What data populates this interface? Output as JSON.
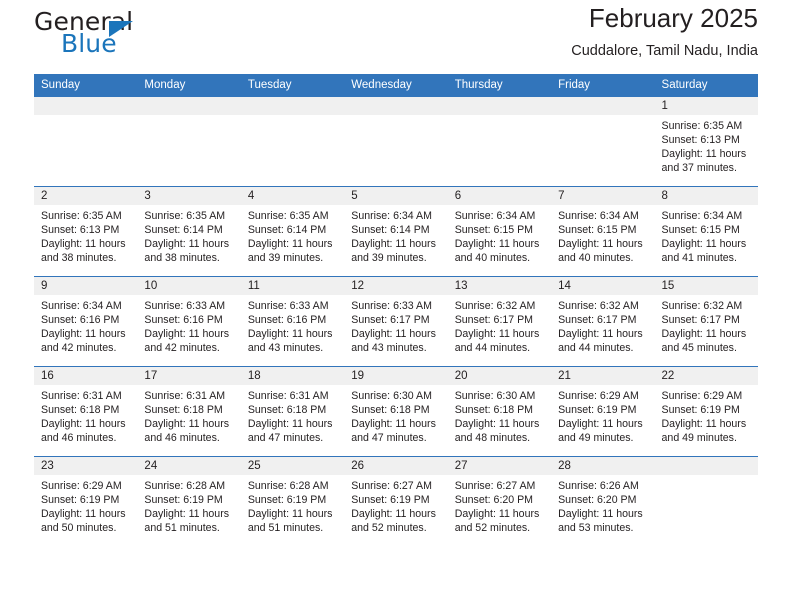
{
  "brand": {
    "word1": "General",
    "word2": "Blue",
    "logo_icon": "triangle-right-icon",
    "accent_color": "#1b75bb"
  },
  "header": {
    "title": "February 2025",
    "location": "Cuddalore, Tamil Nadu, India"
  },
  "theme": {
    "header_bar_color": "#3275bb",
    "daynum_band_color": "#f0f0f0",
    "text_color": "#231f20"
  },
  "labels": {
    "sunrise_prefix": "Sunrise:",
    "sunset_prefix": "Sunset:",
    "daylight_prefix": "Daylight:"
  },
  "weekdays": [
    "Sunday",
    "Monday",
    "Tuesday",
    "Wednesday",
    "Thursday",
    "Friday",
    "Saturday"
  ],
  "weeks": [
    [
      {
        "day": "",
        "sunrise": "",
        "sunset": "",
        "daylight": "",
        "empty": true
      },
      {
        "day": "",
        "sunrise": "",
        "sunset": "",
        "daylight": "",
        "empty": true
      },
      {
        "day": "",
        "sunrise": "",
        "sunset": "",
        "daylight": "",
        "empty": true
      },
      {
        "day": "",
        "sunrise": "",
        "sunset": "",
        "daylight": "",
        "empty": true
      },
      {
        "day": "",
        "sunrise": "",
        "sunset": "",
        "daylight": "",
        "empty": true
      },
      {
        "day": "",
        "sunrise": "",
        "sunset": "",
        "daylight": "",
        "empty": true
      },
      {
        "day": "1",
        "sunrise": "Sunrise: 6:35 AM",
        "sunset": "Sunset: 6:13 PM",
        "daylight": "Daylight: 11 hours and 37 minutes.",
        "empty": false
      }
    ],
    [
      {
        "day": "2",
        "sunrise": "Sunrise: 6:35 AM",
        "sunset": "Sunset: 6:13 PM",
        "daylight": "Daylight: 11 hours and 38 minutes.",
        "empty": false
      },
      {
        "day": "3",
        "sunrise": "Sunrise: 6:35 AM",
        "sunset": "Sunset: 6:14 PM",
        "daylight": "Daylight: 11 hours and 38 minutes.",
        "empty": false
      },
      {
        "day": "4",
        "sunrise": "Sunrise: 6:35 AM",
        "sunset": "Sunset: 6:14 PM",
        "daylight": "Daylight: 11 hours and 39 minutes.",
        "empty": false
      },
      {
        "day": "5",
        "sunrise": "Sunrise: 6:34 AM",
        "sunset": "Sunset: 6:14 PM",
        "daylight": "Daylight: 11 hours and 39 minutes.",
        "empty": false
      },
      {
        "day": "6",
        "sunrise": "Sunrise: 6:34 AM",
        "sunset": "Sunset: 6:15 PM",
        "daylight": "Daylight: 11 hours and 40 minutes.",
        "empty": false
      },
      {
        "day": "7",
        "sunrise": "Sunrise: 6:34 AM",
        "sunset": "Sunset: 6:15 PM",
        "daylight": "Daylight: 11 hours and 40 minutes.",
        "empty": false
      },
      {
        "day": "8",
        "sunrise": "Sunrise: 6:34 AM",
        "sunset": "Sunset: 6:15 PM",
        "daylight": "Daylight: 11 hours and 41 minutes.",
        "empty": false
      }
    ],
    [
      {
        "day": "9",
        "sunrise": "Sunrise: 6:34 AM",
        "sunset": "Sunset: 6:16 PM",
        "daylight": "Daylight: 11 hours and 42 minutes.",
        "empty": false
      },
      {
        "day": "10",
        "sunrise": "Sunrise: 6:33 AM",
        "sunset": "Sunset: 6:16 PM",
        "daylight": "Daylight: 11 hours and 42 minutes.",
        "empty": false
      },
      {
        "day": "11",
        "sunrise": "Sunrise: 6:33 AM",
        "sunset": "Sunset: 6:16 PM",
        "daylight": "Daylight: 11 hours and 43 minutes.",
        "empty": false
      },
      {
        "day": "12",
        "sunrise": "Sunrise: 6:33 AM",
        "sunset": "Sunset: 6:17 PM",
        "daylight": "Daylight: 11 hours and 43 minutes.",
        "empty": false
      },
      {
        "day": "13",
        "sunrise": "Sunrise: 6:32 AM",
        "sunset": "Sunset: 6:17 PM",
        "daylight": "Daylight: 11 hours and 44 minutes.",
        "empty": false
      },
      {
        "day": "14",
        "sunrise": "Sunrise: 6:32 AM",
        "sunset": "Sunset: 6:17 PM",
        "daylight": "Daylight: 11 hours and 44 minutes.",
        "empty": false
      },
      {
        "day": "15",
        "sunrise": "Sunrise: 6:32 AM",
        "sunset": "Sunset: 6:17 PM",
        "daylight": "Daylight: 11 hours and 45 minutes.",
        "empty": false
      }
    ],
    [
      {
        "day": "16",
        "sunrise": "Sunrise: 6:31 AM",
        "sunset": "Sunset: 6:18 PM",
        "daylight": "Daylight: 11 hours and 46 minutes.",
        "empty": false
      },
      {
        "day": "17",
        "sunrise": "Sunrise: 6:31 AM",
        "sunset": "Sunset: 6:18 PM",
        "daylight": "Daylight: 11 hours and 46 minutes.",
        "empty": false
      },
      {
        "day": "18",
        "sunrise": "Sunrise: 6:31 AM",
        "sunset": "Sunset: 6:18 PM",
        "daylight": "Daylight: 11 hours and 47 minutes.",
        "empty": false
      },
      {
        "day": "19",
        "sunrise": "Sunrise: 6:30 AM",
        "sunset": "Sunset: 6:18 PM",
        "daylight": "Daylight: 11 hours and 47 minutes.",
        "empty": false
      },
      {
        "day": "20",
        "sunrise": "Sunrise: 6:30 AM",
        "sunset": "Sunset: 6:18 PM",
        "daylight": "Daylight: 11 hours and 48 minutes.",
        "empty": false
      },
      {
        "day": "21",
        "sunrise": "Sunrise: 6:29 AM",
        "sunset": "Sunset: 6:19 PM",
        "daylight": "Daylight: 11 hours and 49 minutes.",
        "empty": false
      },
      {
        "day": "22",
        "sunrise": "Sunrise: 6:29 AM",
        "sunset": "Sunset: 6:19 PM",
        "daylight": "Daylight: 11 hours and 49 minutes.",
        "empty": false
      }
    ],
    [
      {
        "day": "23",
        "sunrise": "Sunrise: 6:29 AM",
        "sunset": "Sunset: 6:19 PM",
        "daylight": "Daylight: 11 hours and 50 minutes.",
        "empty": false
      },
      {
        "day": "24",
        "sunrise": "Sunrise: 6:28 AM",
        "sunset": "Sunset: 6:19 PM",
        "daylight": "Daylight: 11 hours and 51 minutes.",
        "empty": false
      },
      {
        "day": "25",
        "sunrise": "Sunrise: 6:28 AM",
        "sunset": "Sunset: 6:19 PM",
        "daylight": "Daylight: 11 hours and 51 minutes.",
        "empty": false
      },
      {
        "day": "26",
        "sunrise": "Sunrise: 6:27 AM",
        "sunset": "Sunset: 6:19 PM",
        "daylight": "Daylight: 11 hours and 52 minutes.",
        "empty": false
      },
      {
        "day": "27",
        "sunrise": "Sunrise: 6:27 AM",
        "sunset": "Sunset: 6:20 PM",
        "daylight": "Daylight: 11 hours and 52 minutes.",
        "empty": false
      },
      {
        "day": "28",
        "sunrise": "Sunrise: 6:26 AM",
        "sunset": "Sunset: 6:20 PM",
        "daylight": "Daylight: 11 hours and 53 minutes.",
        "empty": false
      },
      {
        "day": "",
        "sunrise": "",
        "sunset": "",
        "daylight": "",
        "empty": true
      }
    ]
  ]
}
